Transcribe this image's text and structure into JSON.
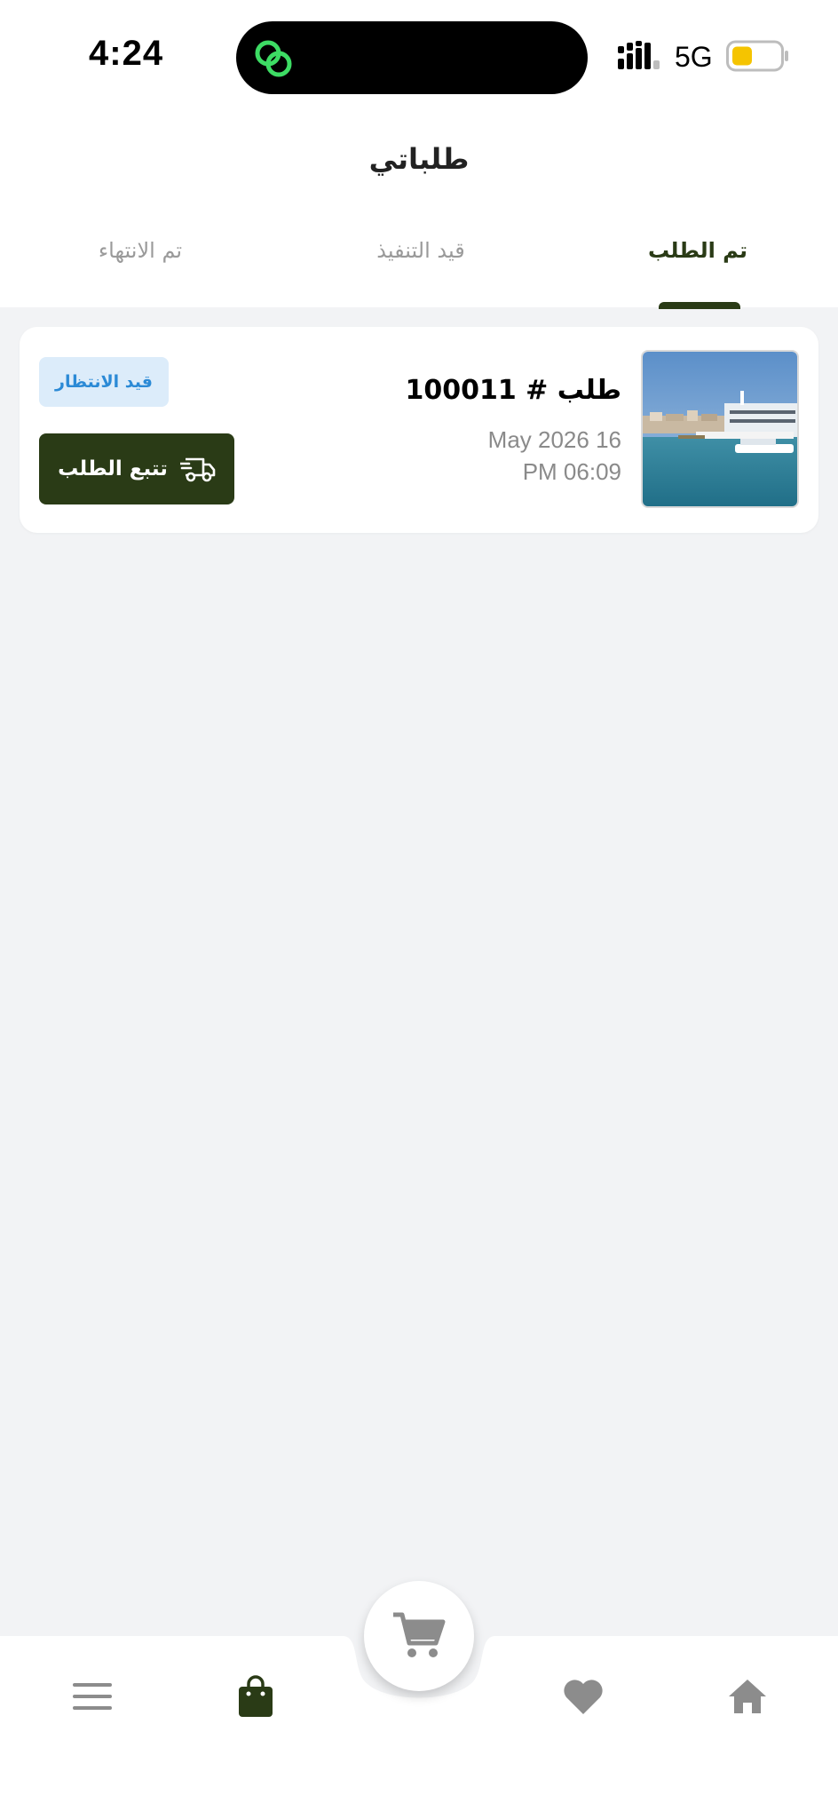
{
  "status_bar": {
    "time": "4:24",
    "network": "5G",
    "battery_color": "#f5c400",
    "island_icon_color": "#3ddc64"
  },
  "header": {
    "title": "طلباتي",
    "tabs": [
      {
        "label": "تم الطلب",
        "active": true
      },
      {
        "label": "قيد التنفيذ",
        "active": false
      },
      {
        "label": "تم الانتهاء",
        "active": false
      }
    ]
  },
  "order": {
    "number": "طلب # 100011",
    "date": "May 2026 16",
    "time": "PM 06:09",
    "status": "قيد الانتظار",
    "track_label": "تتبع الطلب",
    "image_icon": "harbor-photo"
  },
  "bottom_nav": {
    "items": [
      {
        "icon": "menu-icon",
        "active": false
      },
      {
        "icon": "shopping-bag-icon",
        "active": true
      },
      {
        "icon": "cart-icon",
        "active": false
      },
      {
        "icon": "heart-icon",
        "active": false
      },
      {
        "icon": "home-icon",
        "active": false
      }
    ]
  },
  "colors": {
    "primary": "#2a3b16",
    "badge_bg": "#dcecfa",
    "badge_text": "#2b8ad6",
    "inactive_icon": "#8c8c8c"
  }
}
